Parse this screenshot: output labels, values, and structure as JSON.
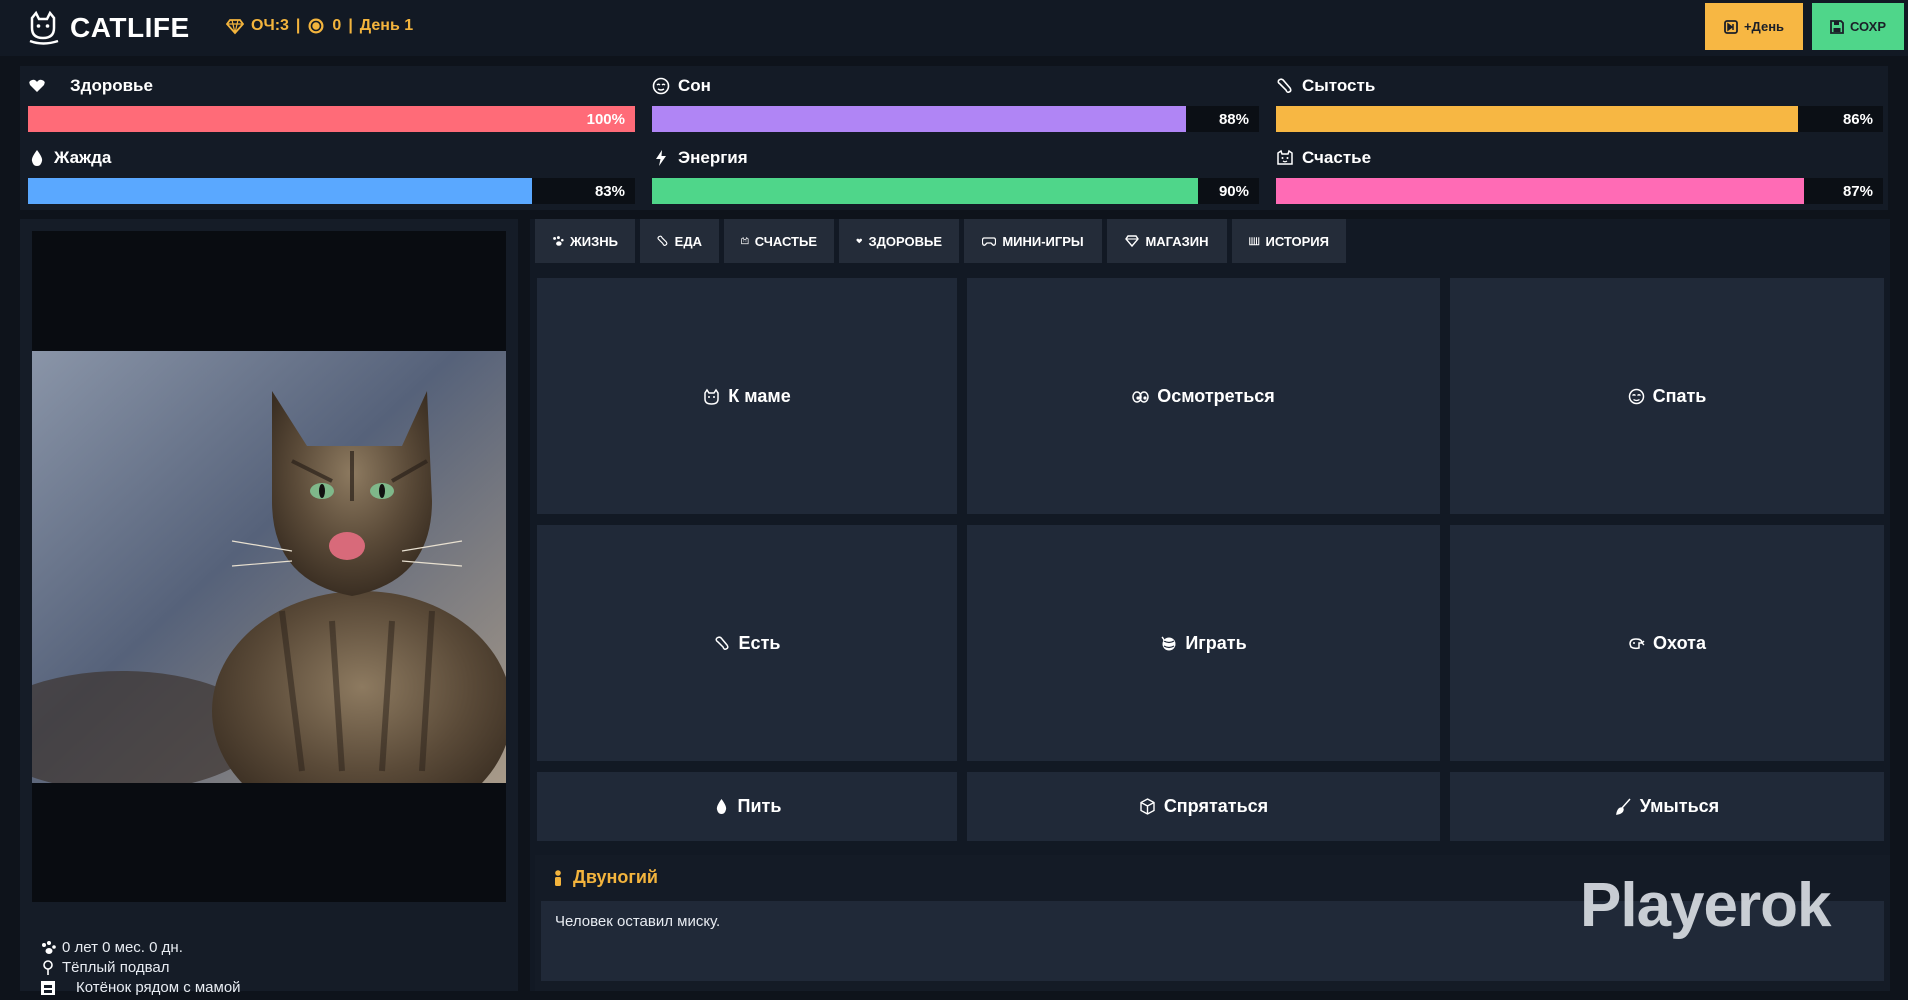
{
  "header": {
    "title": "CATLIFE",
    "hud_points": "ОЧ:3",
    "hud_sep1": "|",
    "hud_coins": "0",
    "hud_sep2": "|",
    "hud_day": "День 1",
    "day_button": "+День",
    "save_button": "СОХР"
  },
  "stats": [
    {
      "label": "Здоровье",
      "value": 100,
      "display": "100%",
      "color": "#ff6b78",
      "icon": "heart-icon"
    },
    {
      "label": "Сон",
      "value": 88,
      "display": "88%",
      "color": "#b085f5",
      "icon": "sleep-face-icon"
    },
    {
      "label": "Сытость",
      "value": 86,
      "display": "86%",
      "color": "#f7b743",
      "icon": "food-icon"
    },
    {
      "label": "Жажда",
      "value": 83,
      "display": "83%",
      "color": "#5aa8ff",
      "icon": "drop-icon"
    },
    {
      "label": "Энергия",
      "value": 90,
      "display": "90%",
      "color": "#4fd68a",
      "icon": "bolt-icon"
    },
    {
      "label": "Счастье",
      "value": 87,
      "display": "87%",
      "color": "#ff6bb5",
      "icon": "cat-face-icon"
    }
  ],
  "profile": {
    "age": "0 лет 0 мес. 0 дн.",
    "location": "Тёплый подвал",
    "status": "Котёнок рядом с мамой"
  },
  "tabs": [
    {
      "label": "ЖИЗНЬ",
      "icon": "paw-icon"
    },
    {
      "label": "ЕДА",
      "icon": "food-icon"
    },
    {
      "label": "СЧАСТЬЕ",
      "icon": "cat-face-icon"
    },
    {
      "label": "ЗДОРОВЬЕ",
      "icon": "heart-icon"
    },
    {
      "label": "МИНИ-ИГРЫ",
      "icon": "gamepad-icon"
    },
    {
      "label": "МАГАЗИН",
      "icon": "gem-icon"
    },
    {
      "label": "ИСТОРИЯ",
      "icon": "book-icon"
    }
  ],
  "actions": [
    {
      "label": "К маме",
      "icon": "cat-icon"
    },
    {
      "label": "Осмотреться",
      "icon": "eyes-icon"
    },
    {
      "label": "Спать",
      "icon": "sleep-face-icon"
    },
    {
      "label": "Есть",
      "icon": "food-icon"
    },
    {
      "label": "Играть",
      "icon": "yarn-icon"
    },
    {
      "label": "Охота",
      "icon": "hunt-icon"
    },
    {
      "label": "Пить",
      "icon": "drop-icon"
    },
    {
      "label": "Спрятаться",
      "icon": "box-icon"
    },
    {
      "label": "Умыться",
      "icon": "brush-icon"
    }
  ],
  "log": {
    "title": "Двуногий",
    "text": "Человек оставил миску."
  },
  "watermark": "Playerok"
}
